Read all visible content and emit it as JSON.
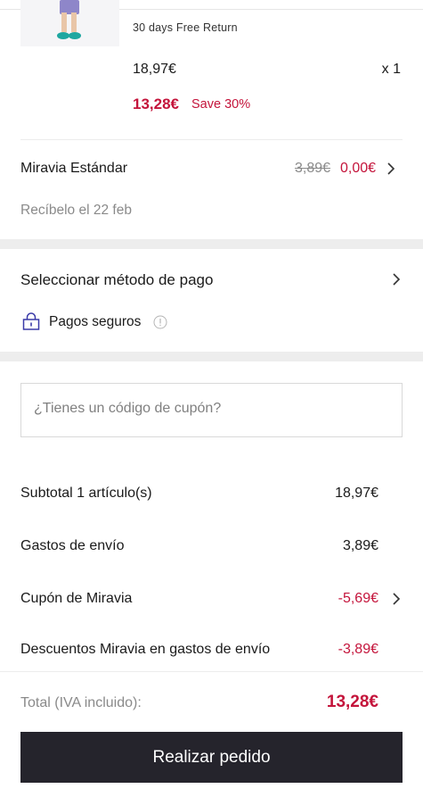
{
  "product": {
    "return_policy": "30 days Free Return",
    "original_price": "18,97€",
    "quantity": "x 1",
    "sale_price": "13,28€",
    "save_text": "Save 30%"
  },
  "shipping": {
    "method": "Miravia Estándar",
    "old_price": "3,89€",
    "new_price": "0,00€",
    "delivery": "Recíbelo el 22 feb"
  },
  "payment": {
    "title": "Seleccionar método de pago",
    "secure_label": "Pagos seguros"
  },
  "coupon": {
    "placeholder": "¿Tienes un código de cupón?"
  },
  "summary": {
    "rows": [
      {
        "label": "Subtotal 1 artículo(s)",
        "value": "18,97€"
      },
      {
        "label": "Gastos de envío",
        "value": "3,89€"
      },
      {
        "label": "Cupón de Miravia",
        "value": "-5,69€"
      },
      {
        "label": "Descuentos Miravia en gastos de envío",
        "value": "-3,89€"
      }
    ],
    "total_label": "Total (IVA incluido):",
    "total_value": "13,28€"
  },
  "cta": {
    "label": "Realizar pedido"
  },
  "colors": {
    "accent": "#c4143b",
    "button": "#25242c",
    "secure_icon": "#3a3aa8"
  },
  "icons": [
    "product-image",
    "chevron-right-icon",
    "lock-icon",
    "info-icon"
  ]
}
